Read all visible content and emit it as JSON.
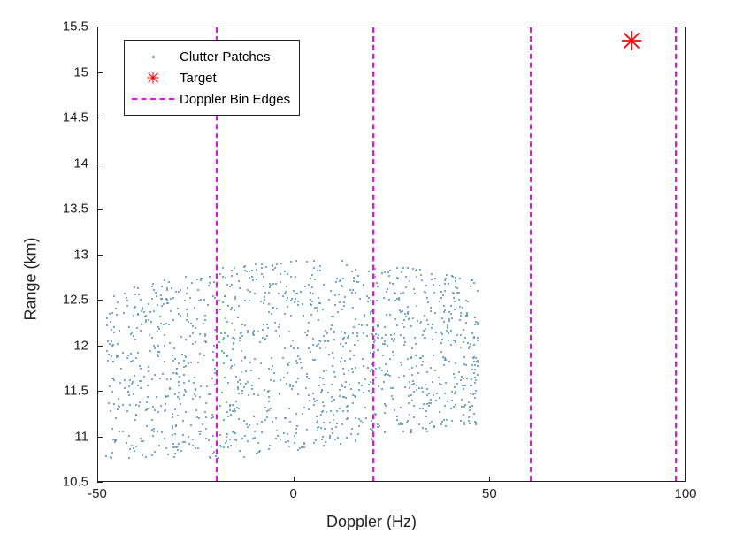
{
  "chart_data": {
    "type": "scatter",
    "title": "",
    "xlabel": "Doppler (Hz)",
    "ylabel": "Range (km)",
    "xlim": [
      -50,
      100
    ],
    "ylim": [
      10.5,
      15.5
    ],
    "xticks": [
      -50,
      0,
      50,
      100
    ],
    "yticks": [
      10.5,
      11,
      11.5,
      12,
      12.5,
      13,
      13.5,
      14,
      14.5,
      15,
      15.5
    ],
    "series": [
      {
        "name": "Clutter Patches",
        "type": "scatter",
        "marker": "dot",
        "color": "#4a90c2",
        "x_range_approx": [
          -48,
          48
        ],
        "y_range_approx": [
          10.75,
          12.95
        ],
        "n_points_approx": 1400,
        "note": "Dense uniform-ish scatter cloud; points randomly distributed within an irregular region roughly spanning Doppler -48 to 48 Hz and Range 10.75 to 12.95 km, with left edge dipping lower (down to ~10.75) and right/top edges curving."
      },
      {
        "name": "Target",
        "type": "scatter",
        "marker": "star",
        "color": "#ff0000",
        "x": [
          86
        ],
        "y": [
          15.35
        ]
      },
      {
        "name": "Doppler Bin Edges",
        "type": "vline",
        "color": "#ff00ff",
        "linestyle": "dashed",
        "x": [
          -20,
          20,
          60,
          97
        ]
      }
    ],
    "legend": {
      "entries": [
        "Clutter Patches",
        "Target",
        "Doppler Bin Edges"
      ],
      "loc": "upper left"
    }
  }
}
